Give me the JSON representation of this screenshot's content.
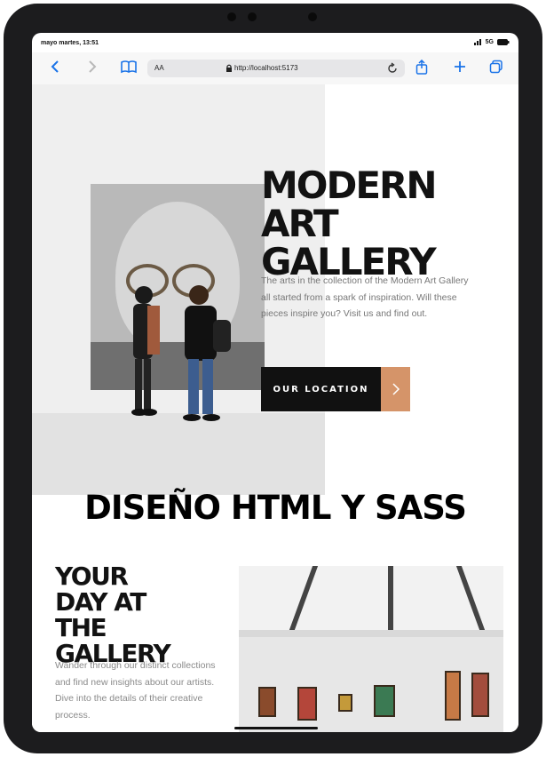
{
  "statusbar": {
    "time": "mayo martes, 13:51",
    "network": "5G"
  },
  "browser": {
    "aa_label": "AA",
    "url": "http://localhost:5173"
  },
  "hero": {
    "title": "MODERN ART GALLERY",
    "description": "The arts in the collection of the Modern Art Gallery all started from a spark of inspiration. Will these pieces inspire you? Visit us and find out.",
    "button_label": "OUR LOCATION"
  },
  "overlay_text": "DISEÑO HTML Y SASS",
  "section": {
    "title": "YOUR DAY AT THE GALLERY",
    "description": "Wander through our distinct collections and find new insights about our artists. Dive into the details of their creative process."
  },
  "icons": [
    "back-icon",
    "forward-icon",
    "bookmarks-icon",
    "lock-icon",
    "reload-icon",
    "share-icon",
    "new-tab-icon",
    "tabs-icon",
    "arrow-right-icon",
    "signal-icon",
    "battery-icon"
  ],
  "colors": {
    "accent": "#d59469",
    "button_bg": "#111111",
    "link_blue": "#1a73e8"
  }
}
